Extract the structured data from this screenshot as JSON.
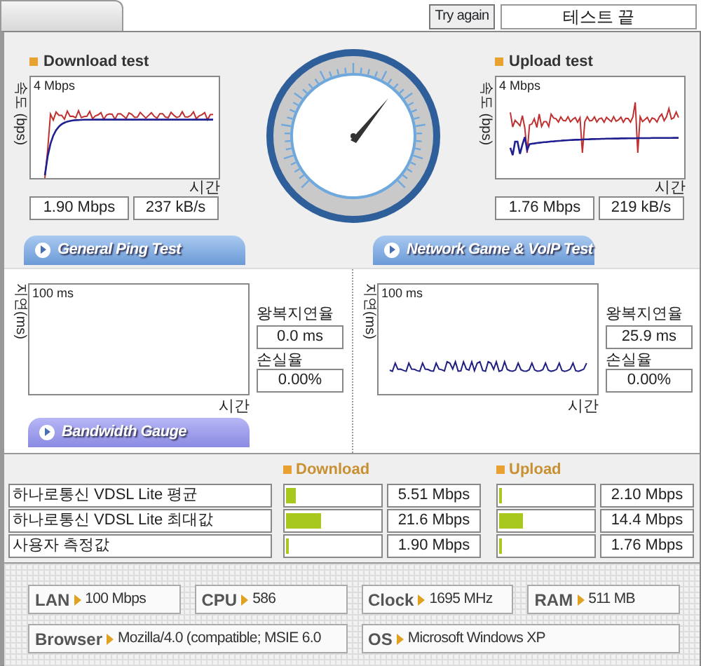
{
  "top_bar": {
    "button": "Try again",
    "status": "테스트 끝"
  },
  "speed_tests": [
    {
      "title": "Download test",
      "y_axis": "속도 (bps)",
      "scale": "4 Mbps",
      "x_axis": "시간",
      "speed": "1.90 Mbps",
      "rate": "237 kB/s",
      "kind": "smooth"
    },
    {
      "title": "Upload test",
      "y_axis": "속도 (bps)",
      "scale": "4 Mbps",
      "x_axis": "시간",
      "speed": "1.76 Mbps",
      "rate": "219 kB/s",
      "kind": "spiky"
    }
  ],
  "test_tabs": [
    {
      "label": "General Ping Test",
      "kind": "ping"
    },
    {
      "label": "Network Game & VoIP Test",
      "kind": "ping"
    }
  ],
  "ping_tests": [
    {
      "y_axis": "지연(ms)",
      "scale": "100 ms",
      "x_axis": "시간",
      "latency_label": "왕복지연율",
      "latency": "0.0 ms",
      "loss_label": "손실율",
      "loss": "0.00%",
      "kind": "empty"
    },
    {
      "y_axis": "지연(ms)",
      "scale": "100 ms",
      "x_axis": "시간",
      "latency_label": "왕복지연율",
      "latency": "25.9 ms",
      "loss_label": "손실율",
      "loss": "0.00%",
      "kind": "trace"
    }
  ],
  "bandwidth_tab": {
    "label": "Bandwidth Gauge",
    "kind": "gauge"
  },
  "bandwidth": {
    "headers": [
      "Download",
      "Upload"
    ],
    "rows": [
      {
        "label": "하나로통신 VDSL Lite 평균",
        "download": {
          "level": 0.1,
          "reading": "5.51 Mbps"
        },
        "upload": {
          "level": 0.03,
          "reading": "2.10 Mbps"
        }
      },
      {
        "label": "하나로통신 VDSL Lite 최대값",
        "download": {
          "level": 0.37,
          "reading": "21.6 Mbps"
        },
        "upload": {
          "level": 0.26,
          "reading": "14.4 Mbps"
        }
      },
      {
        "label": "사용자 측정값",
        "download": {
          "level": 0.03,
          "reading": "1.90 Mbps"
        },
        "upload": {
          "level": 0.03,
          "reading": "1.76 Mbps"
        }
      }
    ]
  },
  "system_info": [
    [
      {
        "label": "LAN",
        "value": "100 Mbps"
      },
      {
        "label": "CPU",
        "value": "586"
      },
      {
        "label": "Clock",
        "value": "1695 MHz"
      },
      {
        "label": "RAM",
        "value": "511 MB"
      }
    ],
    [
      {
        "label": "Browser",
        "value": "Mozilla/4.0 (compatible; MSIE 6.0"
      },
      {
        "label": "OS",
        "value": "Microsoft Windows XP"
      }
    ]
  ]
}
